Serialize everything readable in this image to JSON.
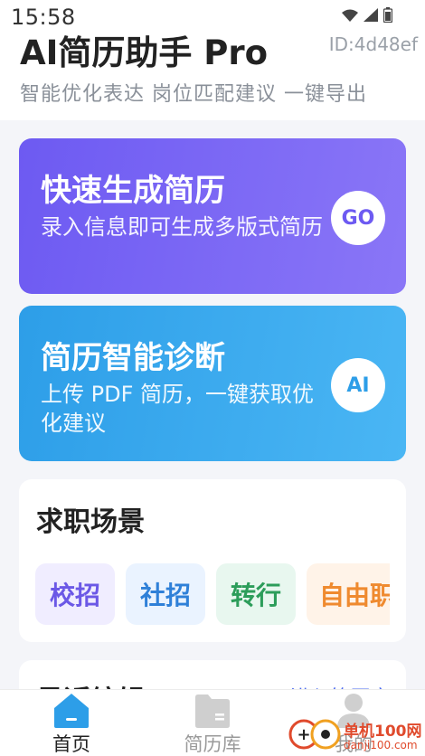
{
  "status_bar": {
    "time": "15:58",
    "icons": [
      "wifi-icon",
      "signal-icon",
      "battery-icon"
    ]
  },
  "header": {
    "title": "AI简历助手 Pro",
    "device_id": "ID:4d48ef",
    "tagline": "智能优化表达 岗位匹配建议 一键导出"
  },
  "cards": [
    {
      "title": "快速生成简历",
      "desc": "录入信息即可生成多版式简历",
      "action": "GO",
      "color_from": "#6d5af2",
      "color_to": "#8a76f7"
    },
    {
      "title": "简历智能诊断",
      "desc": "上传 PDF 简历，一键获取优化建议",
      "action": "AI",
      "color_from": "#2d9ee8",
      "color_to": "#4ab6f4"
    }
  ],
  "scenes": {
    "title": "求职场景",
    "chips": [
      "校招",
      "社招",
      "转行",
      "自由职"
    ]
  },
  "recent": {
    "title": "最近编辑",
    "link": "进入简历库"
  },
  "tabbar": {
    "items": [
      {
        "label": "首页",
        "icon": "home-icon",
        "active": true
      },
      {
        "label": "简历库",
        "icon": "folder-icon",
        "active": false
      },
      {
        "label": "我的",
        "icon": "user-icon",
        "active": false
      }
    ]
  },
  "watermark": {
    "text": "单机100网",
    "sub": "danji100.com"
  },
  "colors": {
    "accent": "#6d5af2",
    "blue": "#2d9ee8",
    "active_tab": "#2d9ee8",
    "inactive_tab": "#9a9a9a"
  }
}
